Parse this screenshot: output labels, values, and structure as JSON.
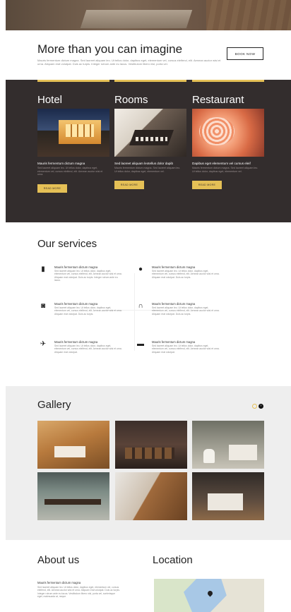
{
  "intro": {
    "title": "More than you can imagine",
    "text": "Mauris fermentum dictum magna. Sed laoreet aliquam leo. Ut tellus dolor, dapibus eget, elementum vel, cursus eleifend, elit. Aenean auctor wisi et urna. Aliquam erat volutpat. Duis ac turpis. Integer rutrum ante eu lacus. Vestibulum libero nisl, porta vel.",
    "book_label": "BOOK NOW"
  },
  "cards": [
    {
      "title": "Hotel",
      "caption": "Mauris fermentum dictum magna",
      "text": "Sed laoreet aliquam leo. Ut tellus dolor, dapibus eget, elementum vel, cursus eleifend, elit. Aenean auctor wisi et urna.",
      "more": "READ MORE"
    },
    {
      "title": "Rooms",
      "caption": "Sed laoreet aliquam leotellus dolor dapib",
      "text": "Mauris fermentum dictum magna. Sed laoreet aliquam leo. Ut tellus dolor, dapibus eget, elementum vel.",
      "more": "READ MORE"
    },
    {
      "title": "Restaurant",
      "caption": "Dapibus eget elementum vel cursus eleif",
      "text": "Mauris fermentum dictum magna. Sed laoreet aliquam leo. Ut tellus dolor, dapibus eget, elementum vel.",
      "more": "READ MORE"
    }
  ],
  "services": {
    "title": "Our services",
    "items": [
      {
        "icon": "book-icon",
        "glyph": "▮",
        "title": "Mauris fermentum dictum magna",
        "text": "Sed laoreet aliquam leo. Ut tellus dolor, dapibus eget, elementum vel, cursus eleifend, elit. Aenean auctor wisi et urna. Aliquam erat volutpat. Duis ac turpis. Integer rutrum ante eu lacus."
      },
      {
        "icon": "map-pin-icon",
        "glyph": "●",
        "title": "Mauris fermentum dictum magna",
        "text": "Sed laoreet aliquam leo. Ut tellus dolor, dapibus eget, elementum vel, cursus eleifend, elit. Aenean auctor wisi et urna. Aliquam erat volutpat. Duis ac turpis."
      },
      {
        "icon": "camera-icon",
        "glyph": "◙",
        "title": "Mauris fermentum dictum magna",
        "text": "Sed laoreet aliquam leo. Ut tellus dolor, dapibus eget, elementum vel, cursus eleifend, elit. Aenean auctor wisi et urna. Aliquam erat volutpat. Duis ac turpis."
      },
      {
        "icon": "headphones-icon",
        "glyph": "∩",
        "title": "Mauris fermentum dictum magna",
        "text": "Sed laoreet aliquam leo. Ut tellus dolor, dapibus eget, elementum vel, cursus eleifend, elit. Aenean auctor wisi et urna. Aliquam erat volutpat. Duis ac turpis."
      },
      {
        "icon": "airplane-icon",
        "glyph": "✈",
        "title": "Mauris fermentum dictum magna",
        "text": "Sed laoreet aliquam leo. Ut tellus dolor, dapibus eget, elementum vel, cursus eleifend, elit. Aenean auctor wisi et urna. Aliquam erat volutpat."
      },
      {
        "icon": "briefcase-icon",
        "glyph": "▬",
        "title": "Mauris fermentum dictum magna",
        "text": "Sed laoreet aliquam leo. Ut tellus dolor, dapibus eget, elementum vel, cursus eleifend, elit. Aenean auctor wisi et urna. Aliquam erat volutpat."
      }
    ]
  },
  "gallery": {
    "title": "Gallery",
    "next_glyph": "›"
  },
  "about": {
    "title": "About us",
    "subtitle": "Mauris fermentum dictum magna",
    "text": "Sed laoreet aliquam leo. Ut tellus dolor, dapibus eget, elementum vel, cursus eleifend, elit. Aenean auctor wisi et urna. Aliquam erat volutpat. Duis ac turpis. Integer rutrum ante eu lacus. Vestibulum libero nisl, porta vel, scelerisque eget, malesuada at, neque."
  },
  "location": {
    "title": "Location"
  },
  "colors": {
    "accent": "#e5c056",
    "dark_section": "#332d2d",
    "gallery_bg": "#eeeeee"
  }
}
